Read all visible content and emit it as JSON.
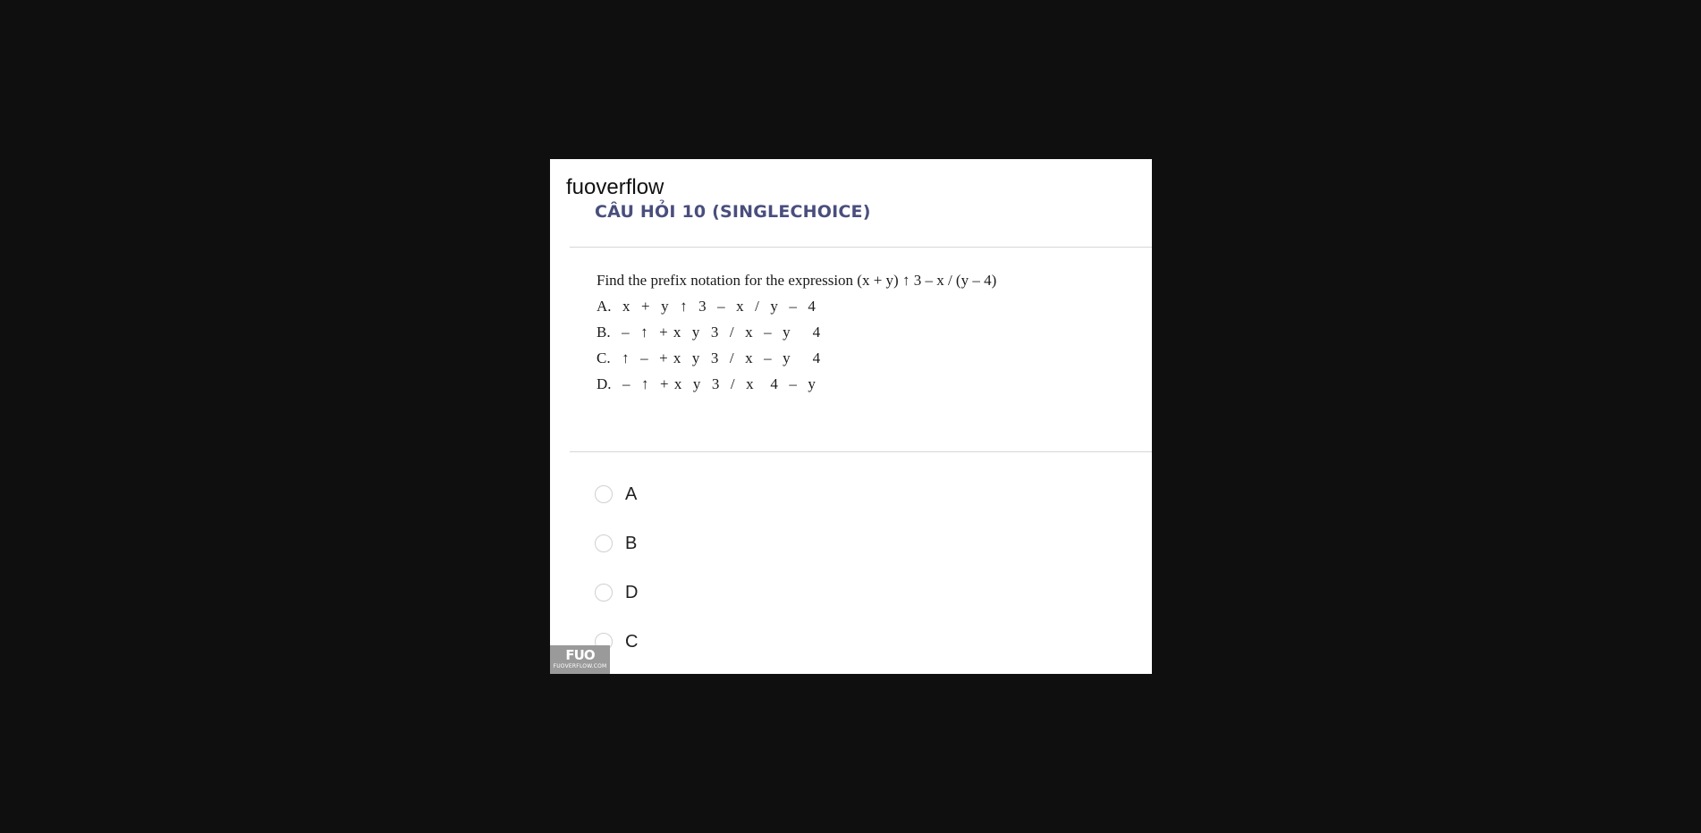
{
  "brand": "fuoverflow",
  "question": {
    "title": "CÂU HỎI 10 (SINGLECHOICE)",
    "stem": "Find the prefix notation for the expression (x + y) ↑ 3 – x / (y – 4)",
    "options": [
      "A.  x  +  y  ↑  3  –  x  /  y  –  4",
      "B.  –  ↑  + x  y  3  /  x  –  y    4",
      "C.  ↑  –  + x  y  3  /  x  –  y    4",
      "D.  –  ↑  + x  y  3  /  x   4  –  y"
    ]
  },
  "choices": [
    "A",
    "B",
    "D",
    "C"
  ],
  "watermark": {
    "logo": "FUO",
    "site": "FUOVERFLOW.COM"
  }
}
